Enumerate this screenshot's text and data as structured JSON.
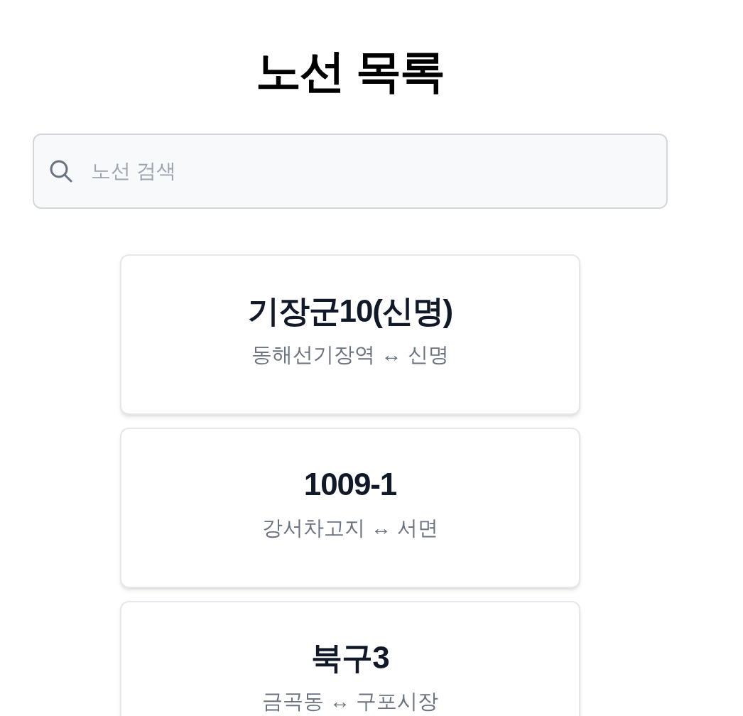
{
  "title": "노선 목록",
  "search": {
    "placeholder": "노선 검색"
  },
  "routes": [
    {
      "name": "기장군10(신명)",
      "from": "동해선기장역",
      "arrow": "↔",
      "to": "신명"
    },
    {
      "name": "1009-1",
      "from": "강서차고지",
      "arrow": "↔",
      "to": "서면"
    },
    {
      "name": "북구3",
      "from": "금곡동",
      "arrow": "↔",
      "to": "구포시장"
    }
  ]
}
